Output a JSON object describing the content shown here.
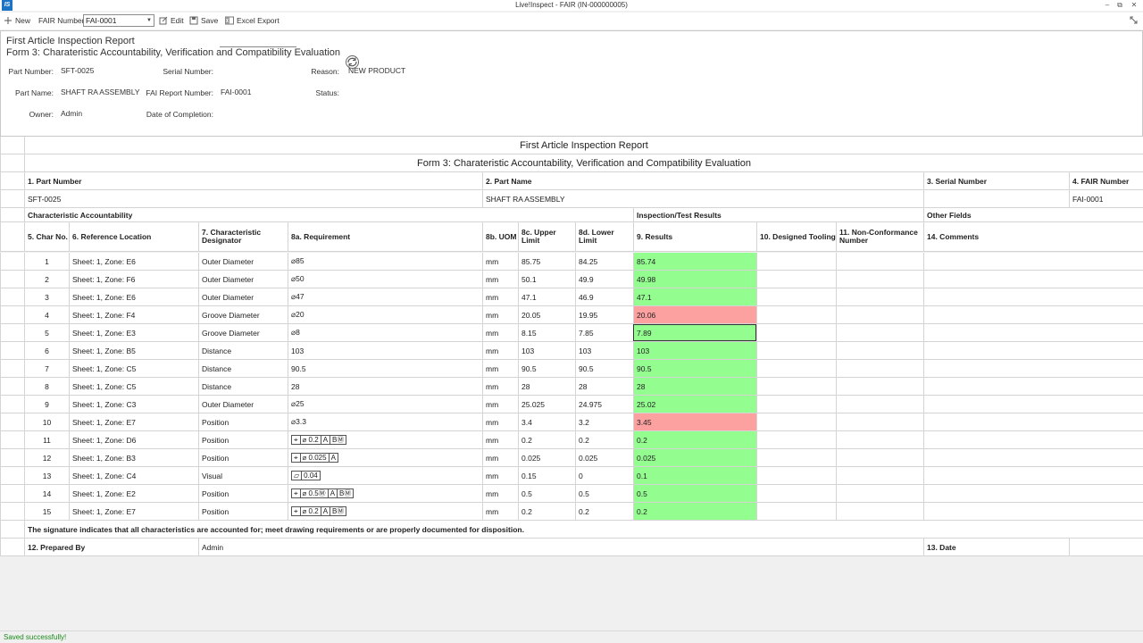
{
  "window": {
    "title": "Live!Inspect - FAIR (IN-000000005)",
    "logo_text": "IS",
    "minimize": "–",
    "restore": "⧉",
    "close": "✕"
  },
  "toolbar": {
    "new_label": "New",
    "fair_number_label": "FAIR Number",
    "fair_number_value": "FAI-0001",
    "edit_label": "Edit",
    "save_label": "Save",
    "excel_label": "Excel Export"
  },
  "header": {
    "title": "First Article Inspection Report",
    "subtitle": "Form 3: Charateristic Accountability, Verification and Compatibility Evaluation",
    "part_number_label": "Part Number:",
    "part_number": "SFT-0025",
    "part_name_label": "Part Name:",
    "part_name": "SHAFT RA ASSEMBLY",
    "owner_label": "Owner:",
    "owner": "Admin",
    "serial_number_label": "Serial Number:",
    "fai_report_label": "FAI Report Number:",
    "fai_report": "FAI-0001",
    "date_completion_label": "Date of Completion:",
    "reason_label": "Reason:",
    "reason": "NEW PRODUCT",
    "status_label": "Status:"
  },
  "report": {
    "title": "First Article Inspection Report",
    "subtitle": "Form 3: Charateristic Accountability, Verification and Compatibility Evaluation",
    "h_part_number": "1. Part Number",
    "h_part_name": "2. Part Name",
    "h_serial_number": "3. Serial Number",
    "h_fair_number": "4. FAIR Number",
    "part_number": "SFT-0025",
    "part_name": "SHAFT RA ASSEMBLY",
    "serial_number": "",
    "fair_number": "FAI-0001",
    "sec_char": "Characteristic Accountability",
    "sec_insp": "Inspection/Test Results",
    "sec_other": "Other Fields",
    "columns": {
      "char_no": "5. Char No.",
      "ref_loc": "6. Reference Location",
      "designator": "7. Characteristic Designator",
      "requirement": "8a. Requirement",
      "uom": "8b. UOM",
      "upper": "8c. Upper Limit",
      "lower": "8d. Lower Limit",
      "results": "9. Results",
      "tooling": "10. Designed Tooling",
      "ncr": "11. Non-Conformance Number",
      "comments": "14. Comments"
    },
    "rows": [
      {
        "no": "1",
        "ref": "Sheet: 1, Zone: E6",
        "des": "Outer Diameter",
        "req": "⌀85",
        "uom": "mm",
        "upper": "85.75",
        "lower": "84.25",
        "result": "85.74",
        "status": "pass"
      },
      {
        "no": "2",
        "ref": "Sheet: 1, Zone: F6",
        "des": "Outer Diameter",
        "req": "⌀50",
        "uom": "mm",
        "upper": "50.1",
        "lower": "49.9",
        "result": "49.98",
        "status": "pass"
      },
      {
        "no": "3",
        "ref": "Sheet: 1, Zone: E6",
        "des": "Outer Diameter",
        "req": "⌀47",
        "uom": "mm",
        "upper": "47.1",
        "lower": "46.9",
        "result": "47.1",
        "status": "pass"
      },
      {
        "no": "4",
        "ref": "Sheet: 1, Zone: F4",
        "des": "Groove Diameter",
        "req": "⌀20",
        "uom": "mm",
        "upper": "20.05",
        "lower": "19.95",
        "result": "20.06",
        "status": "fail"
      },
      {
        "no": "5",
        "ref": "Sheet: 1, Zone: E3",
        "des": "Groove Diameter",
        "req": "⌀8",
        "uom": "mm",
        "upper": "8.15",
        "lower": "7.85",
        "result": "7.89",
        "status": "pass"
      },
      {
        "no": "6",
        "ref": "Sheet: 1, Zone: B5",
        "des": "Distance",
        "req": "103",
        "uom": "mm",
        "upper": "103",
        "lower": "103",
        "result": "103",
        "status": "pass"
      },
      {
        "no": "7",
        "ref": "Sheet: 1, Zone: C5",
        "des": "Distance",
        "req": "90.5",
        "uom": "mm",
        "upper": "90.5",
        "lower": "90.5",
        "result": "90.5",
        "status": "pass"
      },
      {
        "no": "8",
        "ref": "Sheet: 1, Zone: C5",
        "des": "Distance",
        "req": "28",
        "uom": "mm",
        "upper": "28",
        "lower": "28",
        "result": "28",
        "status": "pass"
      },
      {
        "no": "9",
        "ref": "Sheet: 1, Zone: C3",
        "des": "Outer Diameter",
        "req": "⌀25",
        "uom": "mm",
        "upper": "25.025",
        "lower": "24.975",
        "result": "25.02",
        "status": "pass"
      },
      {
        "no": "10",
        "ref": "Sheet: 1, Zone: E7",
        "des": "Position",
        "req": "⌀3.3",
        "uom": "mm",
        "upper": "3.4",
        "lower": "3.2",
        "result": "3.45",
        "status": "fail"
      },
      {
        "no": "11",
        "ref": "Sheet: 1, Zone: D6",
        "des": "Position",
        "gdt": [
          "⌖",
          "⌀ 0.2",
          "A",
          "BⓂ"
        ],
        "uom": "mm",
        "upper": "0.2",
        "lower": "0.2",
        "result": "0.2",
        "status": "pass"
      },
      {
        "no": "12",
        "ref": "Sheet: 1, Zone: B3",
        "des": "Position",
        "gdt": [
          "⌖",
          "⌀ 0.025",
          "A"
        ],
        "uom": "mm",
        "upper": "0.025",
        "lower": "0.025",
        "result": "0.025",
        "status": "pass"
      },
      {
        "no": "13",
        "ref": "Sheet: 1, Zone: C4",
        "des": "Visual",
        "gdt": [
          "⏥",
          "0.04"
        ],
        "uom": "mm",
        "upper": "0.15",
        "lower": "0",
        "result": "0.1",
        "status": "pass"
      },
      {
        "no": "14",
        "ref": "Sheet: 1, Zone: E2",
        "des": "Position",
        "gdt": [
          "⌖",
          "⌀ 0.5Ⓜ",
          "A",
          "BⓂ"
        ],
        "uom": "mm",
        "upper": "0.5",
        "lower": "0.5",
        "result": "0.5",
        "status": "pass"
      },
      {
        "no": "15",
        "ref": "Sheet: 1, Zone: E7",
        "des": "Position",
        "gdt": [
          "⌖",
          "⌀ 0.2",
          "A",
          "BⓂ"
        ],
        "uom": "mm",
        "upper": "0.2",
        "lower": "0.2",
        "result": "0.2",
        "status": "pass"
      }
    ],
    "signature_note": "The signature indicates that all characteristics are accounted for; meet drawing requirements or are properly documented for disposition.",
    "prepared_by_label": "12. Prepared By",
    "prepared_by": "Admin",
    "date_label": "13. Date",
    "date": ""
  },
  "statusbar": {
    "message": "Saved successfully!"
  },
  "colors": {
    "pass": "#94fd90",
    "fail": "#fca0a0",
    "status_ok": "#1a8a1a"
  }
}
